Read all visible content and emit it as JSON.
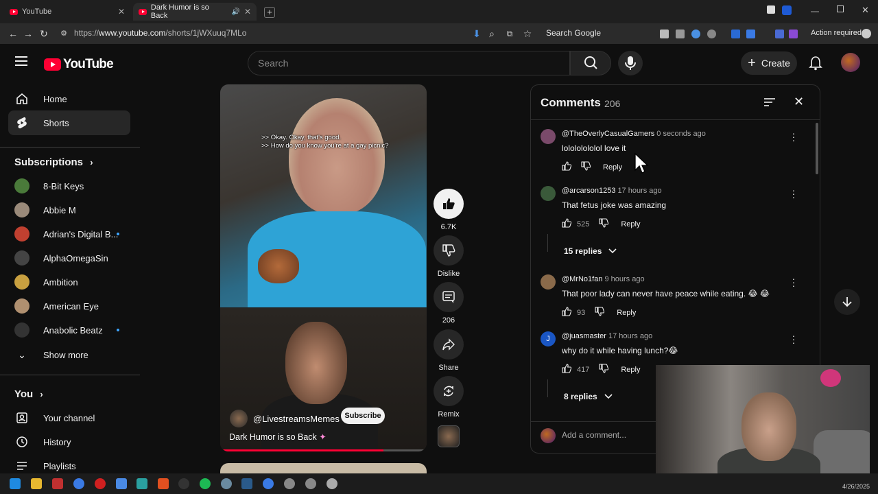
{
  "browser": {
    "tabs": [
      {
        "title": "YouTube",
        "active": false
      },
      {
        "title": "Dark Humor is so Back",
        "active": true
      }
    ],
    "url_prefix": "https://",
    "url_domain": "www.youtube.com",
    "url_path": "/shorts/1jWXuuq7MLo",
    "search_engine_label": "Search Google",
    "action_required": "Action required"
  },
  "header": {
    "logo_text": "YouTube",
    "search_placeholder": "Search",
    "create_label": "Create"
  },
  "sidebar": {
    "main": [
      {
        "label": "Home",
        "icon": "home-icon"
      },
      {
        "label": "Shorts",
        "icon": "shorts-icon",
        "active": true
      }
    ],
    "subscriptions_heading": "Subscriptions",
    "subscriptions": [
      {
        "label": "8-Bit Keys",
        "color": "#4a7a3a",
        "new": false
      },
      {
        "label": "Abbie M",
        "color": "#9a8a7a",
        "new": false
      },
      {
        "label": "Adrian's Digital B...",
        "color": "#c04030",
        "new": true
      },
      {
        "label": "AlphaOmegaSin",
        "color": "#444444",
        "new": false
      },
      {
        "label": "Ambition",
        "color": "#c8a040",
        "new": false
      },
      {
        "label": "American Eye",
        "color": "#b09070",
        "new": false
      },
      {
        "label": "Anabolic Beatz",
        "color": "#333333",
        "new": true
      }
    ],
    "show_more": "Show more",
    "you_heading": "You",
    "you_items": [
      {
        "label": "Your channel",
        "icon": "person-icon"
      },
      {
        "label": "History",
        "icon": "history-icon"
      },
      {
        "label": "Playlists",
        "icon": "playlists-icon"
      }
    ]
  },
  "short": {
    "subtitle_line1": ">> Okay. Okay, that's good.",
    "subtitle_line2": ">> How do you know you're at a gay picnic?",
    "channel": "@LivestreamsMemes",
    "subscribe_label": "Subscribe",
    "title": "Dark Humor is so Back",
    "progress_fraction": 0.79
  },
  "actions": {
    "like_count": "6.7K",
    "dislike_label": "Dislike",
    "comment_count": "206",
    "share_label": "Share",
    "remix_label": "Remix"
  },
  "comments": {
    "title": "Comments",
    "count": "206",
    "add_placeholder": "Add a comment...",
    "items": [
      {
        "author": "@TheOverlyCasualGamers",
        "time": "0 seconds ago",
        "text": "lolololololol love it",
        "likes": "",
        "replies": "",
        "avatar_color": "#7a4a6a"
      },
      {
        "author": "@arcarson1253",
        "time": "17 hours ago",
        "text": "That fetus joke was amazing",
        "likes": "525",
        "replies": "15 replies",
        "avatar_color": "#3a5a3a"
      },
      {
        "author": "@MrNo1fan",
        "time": "9 hours ago",
        "text": "That poor lady can never have peace while eating. 😂 😂",
        "likes": "93",
        "replies": "",
        "avatar_color": "#8a6a4a"
      },
      {
        "author": "@juasmaster",
        "time": "17 hours ago",
        "text": "why do it while having lunch?😂",
        "likes": "417",
        "replies": "8 replies",
        "avatar_color": "#1a56c4",
        "avatar_letter": "J"
      }
    ],
    "reply_label": "Reply"
  },
  "taskbar": {
    "date": "4/26/2025"
  }
}
